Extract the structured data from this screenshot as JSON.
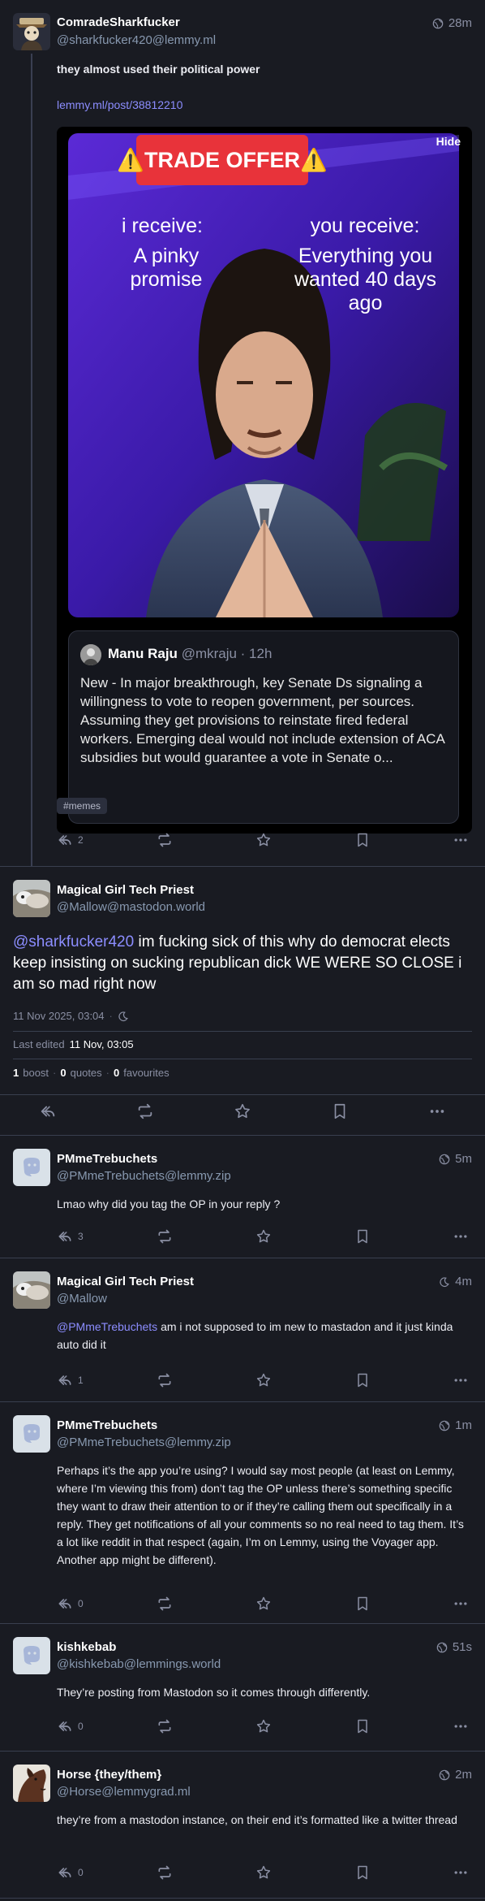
{
  "main_post": {
    "author_name": "ComradeSharkfucker",
    "author_handle": "@sharkfucker420@lemmy.ml",
    "time": "28m",
    "title": "they almost used their political power",
    "link": "lemmy.ml/post/38812210",
    "hide_label": "Hide",
    "hashtag": "#memes",
    "reply_count": "2",
    "meme": {
      "banner": "⚠️TRADE OFFER⚠️",
      "left_heading": "i receive:",
      "left_text": "A pinky promise",
      "right_heading": "you receive:",
      "right_text": "Everything you wanted 40 days ago",
      "tweet_name": "Manu Raju",
      "tweet_handle": "@mkraju · 12h",
      "tweet_text": "New - In major breakthrough, key Senate Ds signaling a willingness to vote to reopen government, per sources. Assuming they get provisions to reinstate fired federal workers. Emerging deal would not include extension of ACA subsidies but would guarantee a vote in Senate o..."
    }
  },
  "focus_post": {
    "author_name": "Magical Girl Tech Priest",
    "author_handle": "@Mallow@mastodon.world",
    "mention": "@sharkfucker420",
    "text": " im fucking sick of this why do democrat elects keep insisting on sucking republican dick WE WERE SO CLOSE i am so mad right now",
    "date": "11 Nov 2025, 03:04",
    "edited_label": "Last edited",
    "edited_value": "11 Nov, 03:05",
    "boosts_count": "1",
    "boosts_label": "boost",
    "quotes_count": "0",
    "quotes_label": "quotes",
    "favs_count": "0",
    "favs_label": "favourites"
  },
  "replies": [
    {
      "author_name": "PMmeTrebuchets",
      "author_handle": "@PMmeTrebuchets@lemmy.zip",
      "time": "5m",
      "text": "Lmao why did you tag the OP in your reply ?",
      "reply_count": "3"
    },
    {
      "author_name": "Magical Girl Tech Priest",
      "author_handle": "@Mallow",
      "time": "4m",
      "mention": "@PMmeTrebuchets",
      "text": " am i not supposed to im new to mastadon and it just kinda auto did it",
      "reply_count": "1"
    },
    {
      "author_name": "PMmeTrebuchets",
      "author_handle": "@PMmeTrebuchets@lemmy.zip",
      "time": "1m",
      "text": "Perhaps it’s the app you’re using? I would say most people (at least on Lemmy, where I’m viewing this from) don’t tag the OP unless there’s something specific they want to draw their attention to or if they’re calling them out specifically in a reply. They get notifications of all your comments so no real need to tag them. It’s a lot like reddit in that respect (again, I’m on Lemmy, using the Voyager app. Another app might be different).",
      "reply_count": "0"
    },
    {
      "author_name": "kishkebab",
      "author_handle": "@kishkebab@lemmings.world",
      "time": "51s",
      "text": "They’re posting from Mastodon so it comes through differently.",
      "reply_count": "0"
    },
    {
      "author_name": "Horse {they/them}",
      "author_handle": "@Horse@lemmygrad.ml",
      "time": "2m",
      "text": "they’re from a mastodon instance, on their end it’s formatted like a twitter thread",
      "reply_count": "0"
    }
  ],
  "colors": {
    "background": "#191b22",
    "accent": "#8c8dff",
    "muted": "#8a8fa3"
  },
  "icons": [
    "globe-icon",
    "moon-icon",
    "reply-icon",
    "boost-icon",
    "star-icon",
    "bookmark-icon",
    "more-icon"
  ]
}
